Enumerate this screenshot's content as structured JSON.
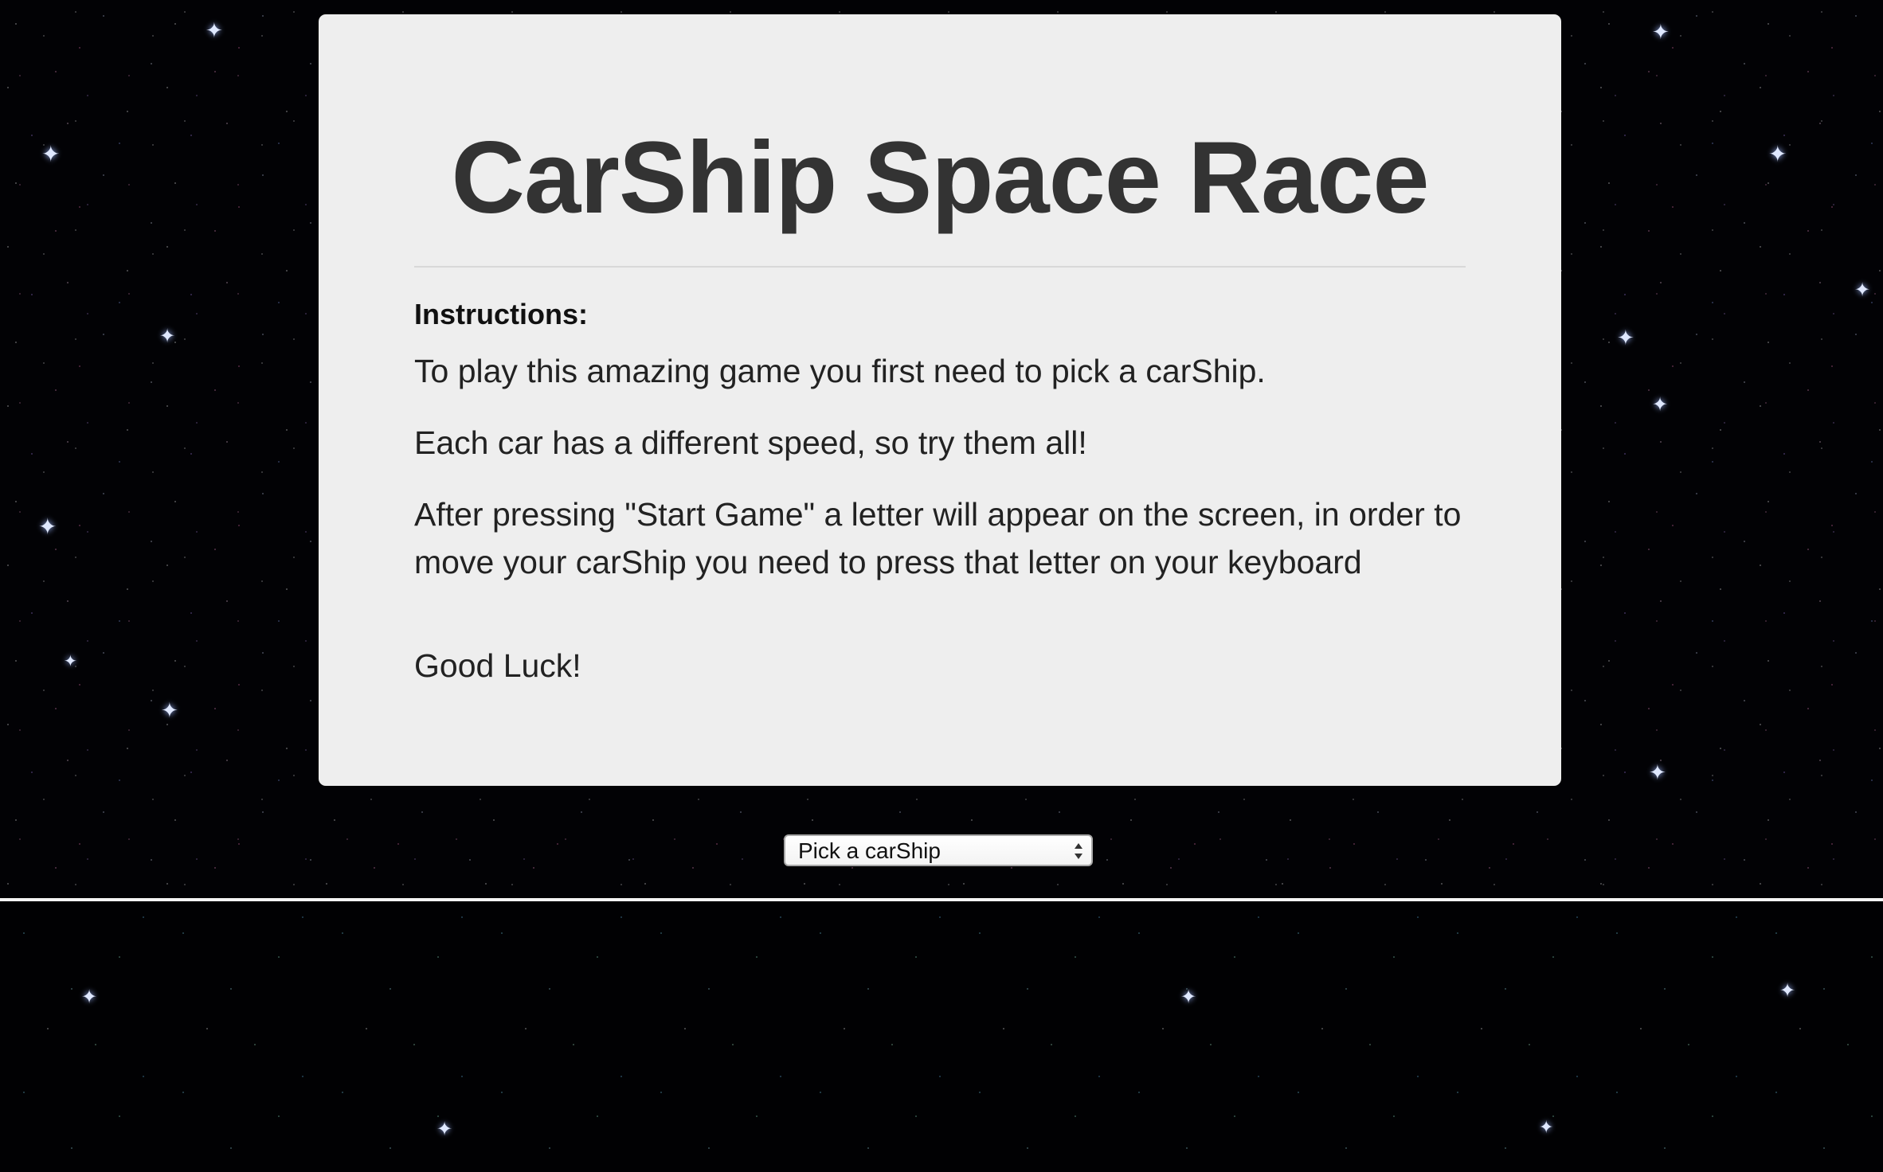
{
  "page": {
    "title": "CarShip Space Race"
  },
  "instructions": {
    "heading": "Instructions:",
    "paragraphs": [
      "To play this amazing game you first need to pick a carShip.",
      "Each car has a different speed, so try them all!",
      "After pressing \"Start Game\" a letter will appear on the screen, in order to move your carShip you need to press that letter on your keyboard",
      "Good Luck!"
    ]
  },
  "car_select": {
    "selected": "Pick a carShip"
  },
  "colors": {
    "card_background": "#eeeeee",
    "title_text": "#333333",
    "page_background": "#000000",
    "divider_line": "#f4f4f4"
  },
  "icons": {
    "select_arrows": "up-down-chevron-icon",
    "star_sparkle": "sparkle-icon"
  }
}
